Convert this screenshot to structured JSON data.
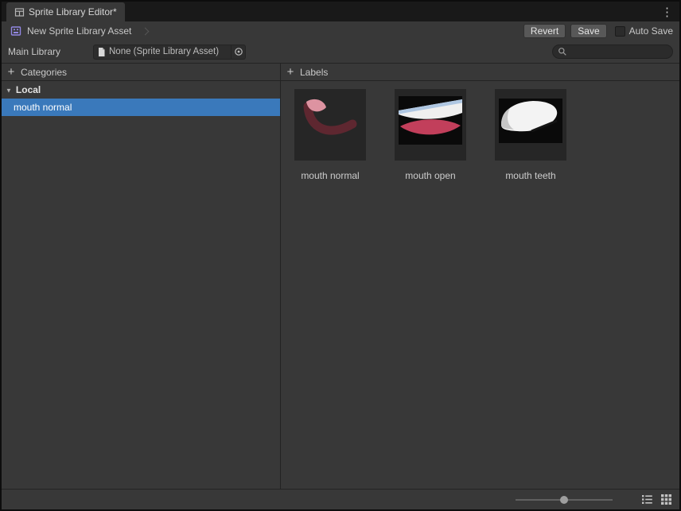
{
  "window": {
    "tab_title": "Sprite Library Editor*"
  },
  "icons": {
    "kebab": "⋮",
    "plus": "+",
    "foldout": "▼"
  },
  "toolbar": {
    "breadcrumb": "New Sprite Library Asset",
    "revert": "Revert",
    "save": "Save",
    "auto_save": "Auto Save",
    "auto_save_checked": false
  },
  "library": {
    "label": "Main Library",
    "value": "None (Sprite Library Asset)"
  },
  "search": {
    "placeholder": ""
  },
  "panels": {
    "categories": {
      "title": "Categories",
      "group": "Local",
      "items": [
        {
          "label": "mouth normal",
          "selected": true
        }
      ]
    },
    "labels": {
      "title": "Labels",
      "items": [
        {
          "label": "mouth normal"
        },
        {
          "label": "mouth open"
        },
        {
          "label": "mouth teeth"
        }
      ]
    }
  },
  "colors": {
    "selection": "#3a79bb",
    "background": "#383838",
    "accent_purple": "#9287e2"
  }
}
